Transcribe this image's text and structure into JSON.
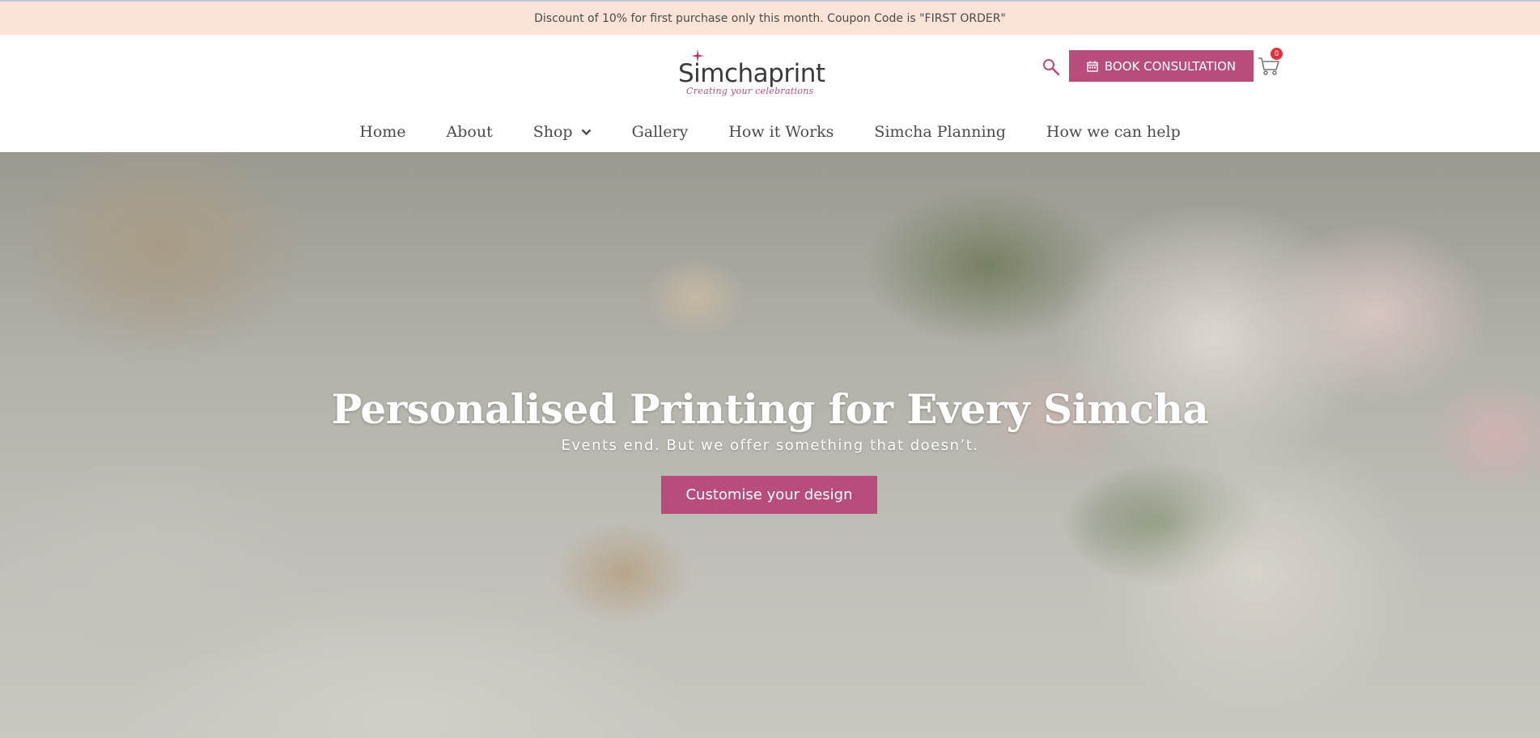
{
  "announcement": {
    "text": "Discount of 10% for first purchase only this month. Coupon Code is \"FIRST ORDER\""
  },
  "header": {
    "logo": {
      "name": "Simchaprint",
      "tagline": "Creating your celebrations"
    },
    "search_icon": "search-icon",
    "book_label": "BOOK CONSULTATION",
    "cart_count": "0"
  },
  "nav": {
    "items": [
      {
        "label": "Home"
      },
      {
        "label": "About"
      },
      {
        "label": "Shop"
      },
      {
        "label": "Gallery"
      },
      {
        "label": "How it Works"
      },
      {
        "label": "Simcha Planning"
      },
      {
        "label": "How we can help"
      }
    ]
  },
  "hero": {
    "title": "Personalised Printing for Every Simcha",
    "subtitle": "Events end. But we offer something that doesn’t.",
    "cta_label": "Customise your design"
  },
  "colors": {
    "accent": "#b84d7c",
    "announcement_bg": "#fbe3d8",
    "badge": "#e0323a"
  }
}
